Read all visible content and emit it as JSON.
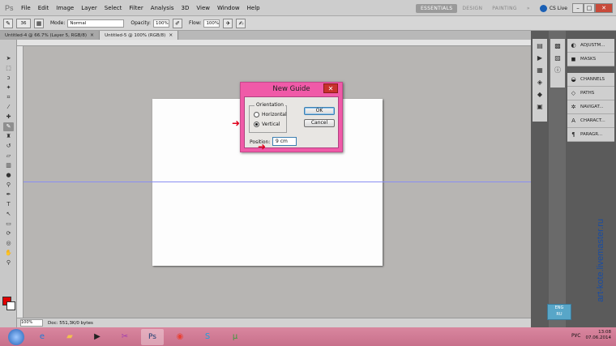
{
  "app": {
    "logo": "Ps"
  },
  "menu": [
    "File",
    "Edit",
    "Image",
    "Layer",
    "Select",
    "Filter",
    "Analysis",
    "3D",
    "View",
    "Window",
    "Help"
  ],
  "workspaces": {
    "essentials": "ESSENTIALS",
    "design": "DESIGN",
    "painting": "PAINTING",
    "more": "»"
  },
  "cs_live": "CS Live",
  "window_buttons": {
    "minimize": "–",
    "restore": "□",
    "close": "✕"
  },
  "options": {
    "brush_size": "36",
    "mode_label": "Mode:",
    "mode_value": "Normal",
    "opacity_label": "Opacity:",
    "opacity_value": "100%",
    "flow_label": "Flow:",
    "flow_value": "100%"
  },
  "tabs": [
    {
      "label": "Untitled-4 @ 66.7% (Layer 5, RGB/8)",
      "close": "×"
    },
    {
      "label": "Untitled-5 @ 100% (RGB/8)",
      "close": "×"
    }
  ],
  "status": {
    "zoom": "100%",
    "doc": "Doc: 551,3K/0 bytes"
  },
  "panels": [
    {
      "icon": "adjustments-icon",
      "label": "ADJUSTM..."
    },
    {
      "icon": "masks-icon",
      "label": "MASKS"
    },
    {
      "icon": "channels-icon",
      "label": "CHANNELS"
    },
    {
      "icon": "paths-icon",
      "label": "PATHS"
    },
    {
      "icon": "navigator-icon",
      "label": "NAVIGAT..."
    },
    {
      "icon": "character-icon",
      "label": "CHARACT..."
    },
    {
      "icon": "paragraph-icon",
      "label": "PARAGR..."
    }
  ],
  "dialog": {
    "title": "New Guide",
    "orientation_legend": "Orientation",
    "horizontal_label": "Horizontal",
    "vertical_label": "Vertical",
    "selected": "vertical",
    "ok_label": "OK",
    "cancel_label": "Cancel",
    "position_label": "Position:",
    "position_value": "9 cm",
    "accent_color": "#f05aa8"
  },
  "badge": {
    "line1": "ENG",
    "line2": "RU"
  },
  "watermark": "art-kote.livemaster.ru",
  "taskbar": {
    "apps": [
      "ie-icon",
      "explorer-icon",
      "media-icon",
      "screenshot-icon",
      "photoshop-icon",
      "chrome-icon",
      "skype-icon",
      "utorrent-icon"
    ],
    "active_app": "photoshop-icon",
    "lang": "РУС",
    "time": "13:08",
    "date": "07.06.2014"
  },
  "colors": {
    "foreground": "#e00000",
    "background": "#ffffff",
    "guide": "#8a8ef2"
  }
}
